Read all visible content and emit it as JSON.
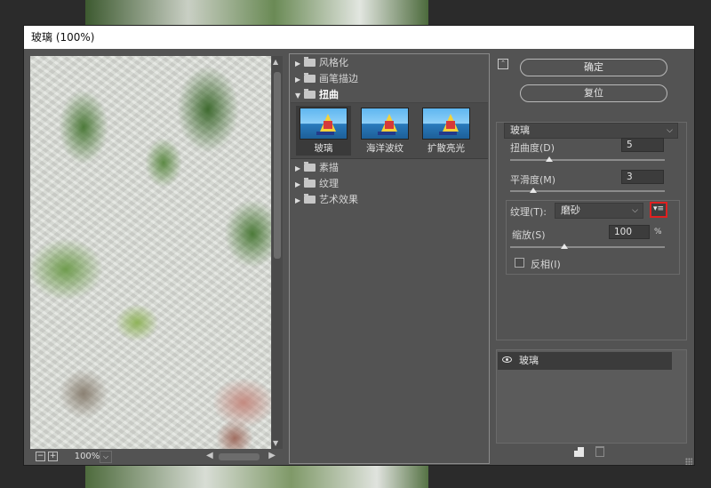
{
  "window": {
    "title": "玻璃 (100%)"
  },
  "preview": {
    "zoom": "100%",
    "zoom_out_icon": "minus",
    "zoom_in_icon": "plus"
  },
  "gallery": {
    "categories": [
      {
        "label": "风格化",
        "expanded": false
      },
      {
        "label": "画笔描边",
        "expanded": false
      },
      {
        "label": "扭曲",
        "expanded": true
      },
      {
        "label": "素描",
        "expanded": false
      },
      {
        "label": "纹理",
        "expanded": false
      },
      {
        "label": "艺术效果",
        "expanded": false
      }
    ],
    "filters": [
      {
        "label": "玻璃",
        "selected": true
      },
      {
        "label": "海洋波纹",
        "selected": false
      },
      {
        "label": "扩散亮光",
        "selected": false
      }
    ]
  },
  "buttons": {
    "ok": "确定",
    "reset": "复位"
  },
  "settings": {
    "filter_select": "玻璃",
    "distortion": {
      "label": "扭曲度(D)",
      "value": "5",
      "level": 0.25
    },
    "smoothness": {
      "label": "平滑度(M)",
      "value": "3",
      "level": 0.15
    },
    "texture": {
      "label": "纹理(T):",
      "value": "磨砂"
    },
    "scaling": {
      "label": "缩放(S)",
      "value": "100",
      "unit": "%",
      "level": 0.35
    },
    "invert": {
      "label": "反相(I)",
      "checked": false
    }
  },
  "layers": {
    "items": [
      {
        "name": "玻璃",
        "visible": true
      }
    ]
  },
  "colors": {
    "dialog_bg": "#535353",
    "highlight": "#e02020"
  }
}
